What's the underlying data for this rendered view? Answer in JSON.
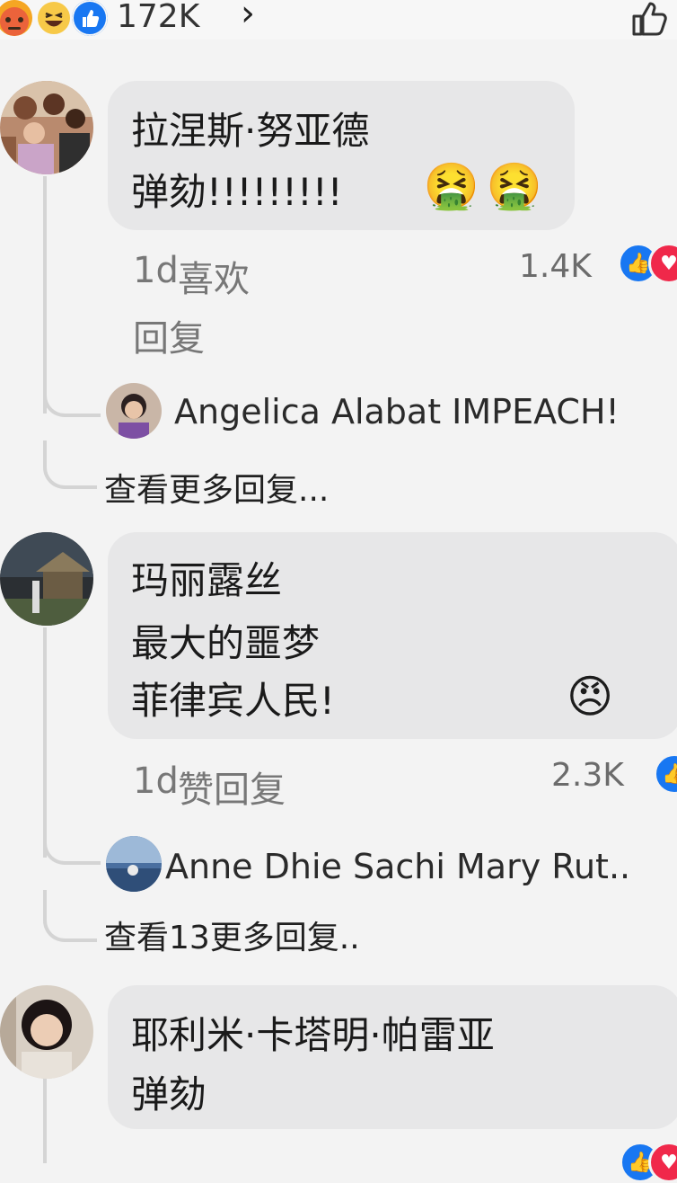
{
  "top": {
    "reactions": [
      "angry-icon",
      "haha-icon",
      "like-icon"
    ],
    "count": "172K",
    "chevron": "›"
  },
  "comments": [
    {
      "line1": "拉涅斯·努亚德",
      "line2": "弹劾!!!!!!!!!",
      "emoji": "🤮",
      "meta_time": "1d",
      "meta_action": "喜欢",
      "reply_label": "回复",
      "reaction_count": "1.4K",
      "reply_preview": "Angelica Alabat IMPEACH!",
      "more_replies": "查看更多回复..."
    },
    {
      "line1": "玛丽露丝",
      "line2": "最大的噩梦",
      "line3": "菲律宾人民!",
      "emoji": "😠",
      "meta_time": "1d",
      "meta_action": "赞回复",
      "reaction_count": "2.3K",
      "reply_preview": "Anne Dhie Sachi Mary Rut..",
      "more_replies": "查看13更多回复.."
    },
    {
      "line1": "耶利米·卡塔明·帕雷亚",
      "line2": "弹劾"
    }
  ],
  "colors": {
    "like_blue": "#1877f2",
    "love_red": "#f0284a",
    "bubble": "#e7e7e8"
  }
}
